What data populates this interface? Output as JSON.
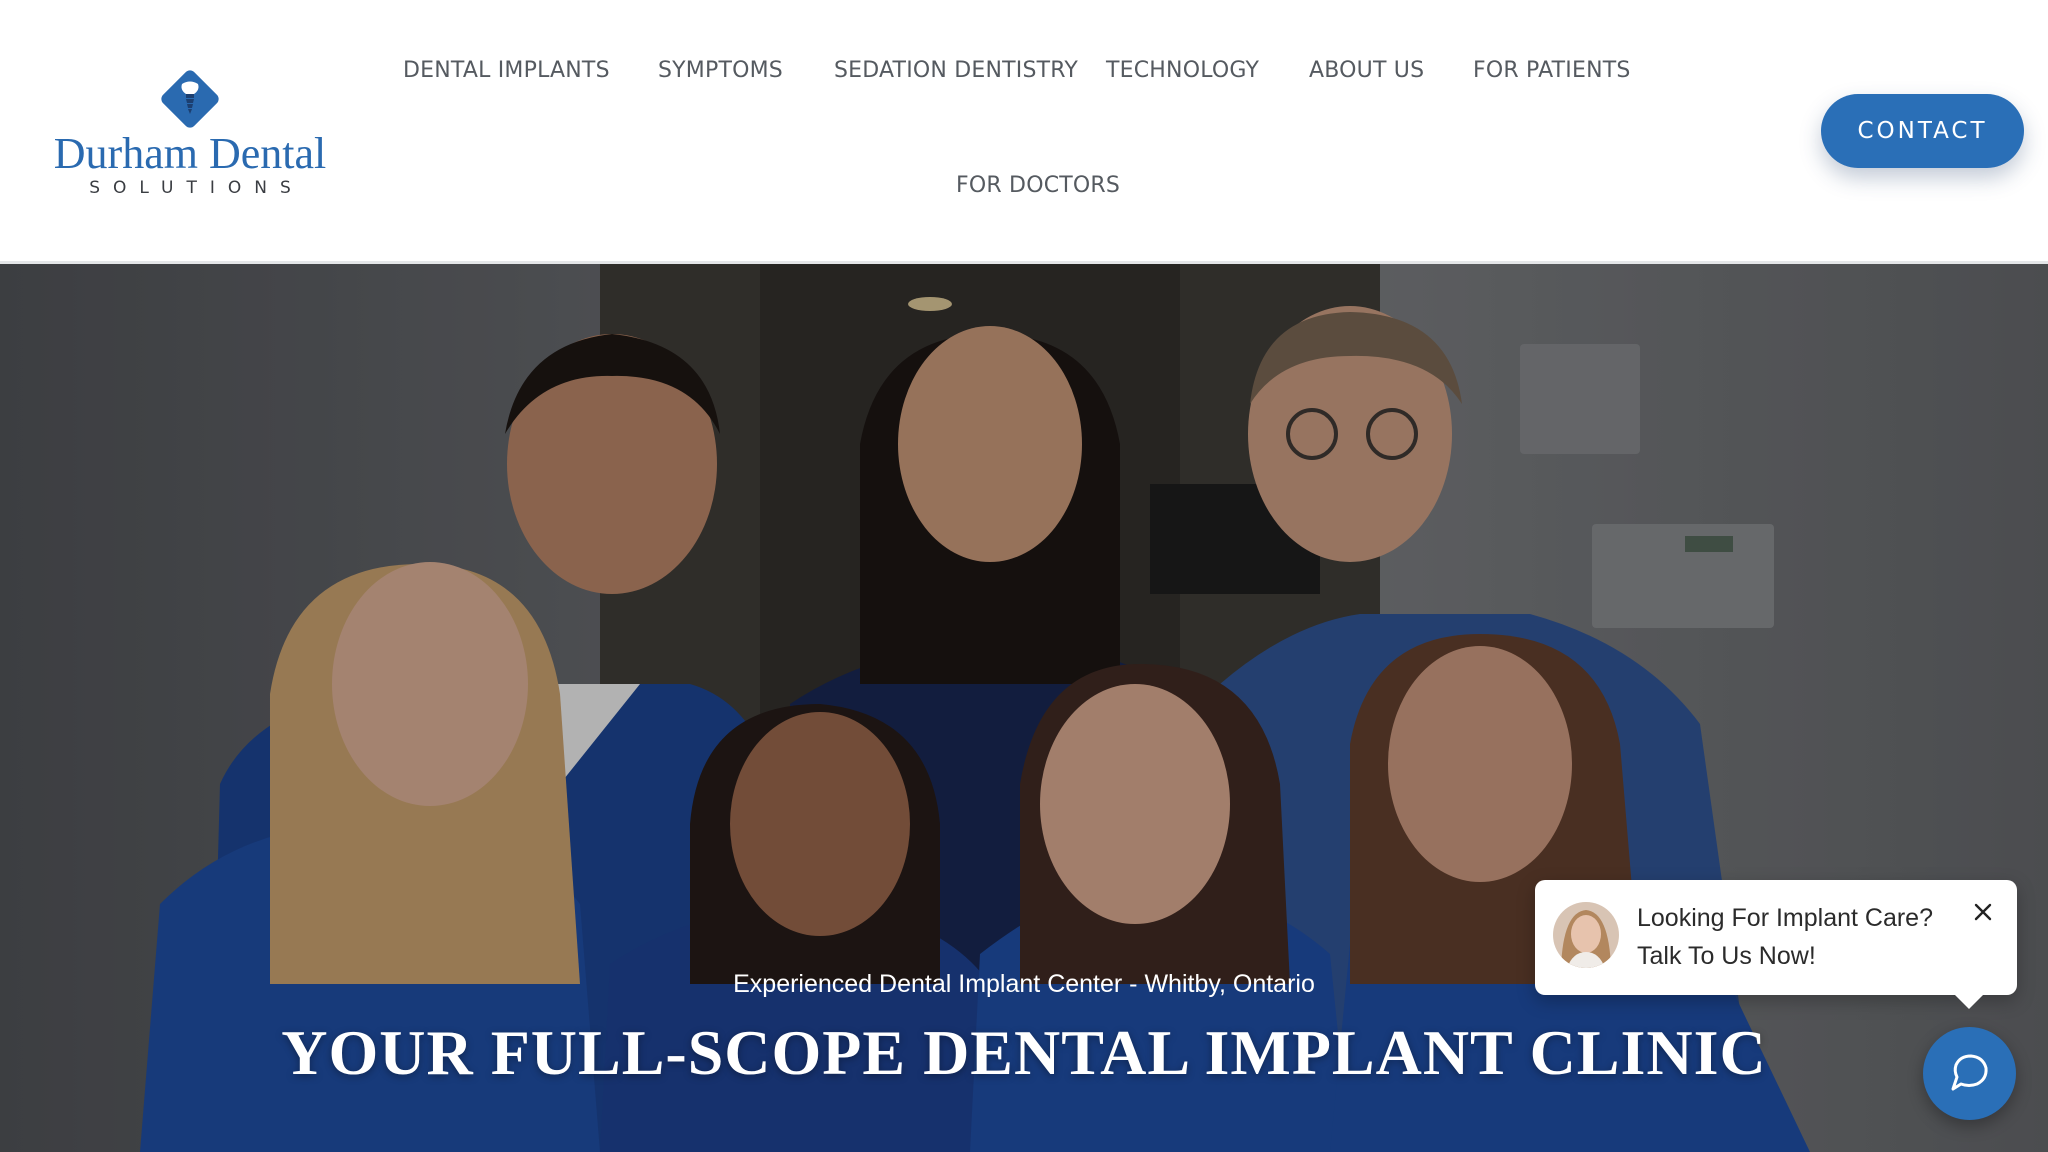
{
  "brand": {
    "name": "Durham Dental",
    "tagline": "SOLUTIONS",
    "accent_color": "#2a6fb7"
  },
  "nav": {
    "items": [
      {
        "label": "DENTAL IMPLANTS"
      },
      {
        "label": "SYMPTOMS"
      },
      {
        "label": "SEDATION DENTISTRY"
      },
      {
        "label": "TECHNOLOGY"
      },
      {
        "label": "ABOUT US"
      },
      {
        "label": "FOR PATIENTS"
      },
      {
        "label": "FOR DOCTORS"
      }
    ],
    "contact_label": "CONTACT"
  },
  "hero": {
    "subtitle": "Experienced Dental Implant Center - Whitby, Ontario",
    "title": "YOUR FULL-SCOPE DENTAL IMPLANT CLINIC"
  },
  "chat": {
    "line1": "Looking For Implant Care?",
    "line2": "Talk To Us Now!",
    "close_icon": "close-icon",
    "launcher_icon": "chat-icon"
  }
}
